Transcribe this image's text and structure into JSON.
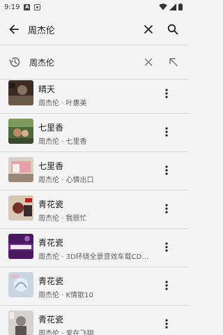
{
  "status_bar": {
    "time": "9:19",
    "badge": "A"
  },
  "search": {
    "query": "周杰伦"
  },
  "history": [
    {
      "text": "周杰伦"
    }
  ],
  "songs": [
    {
      "title": "晴天",
      "subtitle": "周杰伦 · 叶惠美",
      "cover_color": "#3b2d24"
    },
    {
      "title": "七里香",
      "subtitle": "周杰伦 · 七里香",
      "cover_color": "#4f6a3c"
    },
    {
      "title": "七里香",
      "subtitle": "周杰伦 · 心情出口",
      "cover_color": "#c9b8a7"
    },
    {
      "title": "青花瓷",
      "subtitle": "周杰伦 · 我很忙",
      "cover_color": "#7a2e2a"
    },
    {
      "title": "青花瓷",
      "subtitle": "周杰伦 · 3D环绕全景音效车载CD…",
      "cover_color": "#5a1f70"
    },
    {
      "title": "青花瓷",
      "subtitle": "周杰伦 · K情歌10",
      "cover_color": "#b9c7d6"
    },
    {
      "title": "青花瓷",
      "subtitle": "周杰伦 · 爱在飞翔",
      "cover_color": "#c8c4c2"
    }
  ],
  "colors": {
    "background": "#f4f4f4",
    "icon": "#333333",
    "divider": "#d6d6d6"
  }
}
